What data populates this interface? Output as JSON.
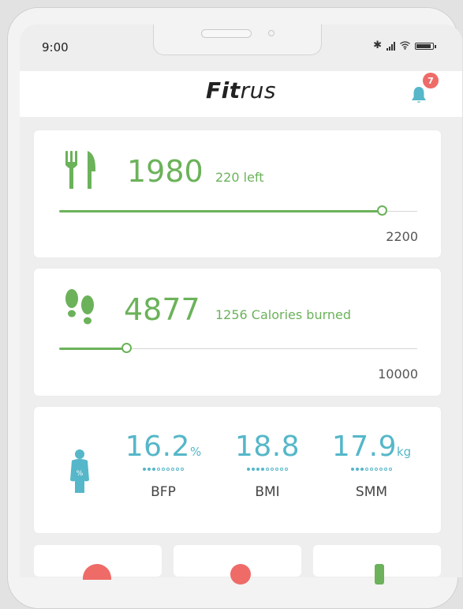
{
  "status_bar": {
    "time": "9:00"
  },
  "header": {
    "title_bold": "Fit",
    "title_rest": "rus",
    "notification_count": "7"
  },
  "calories_card": {
    "value": "1980",
    "remaining_text": "220 left",
    "goal": "2200",
    "progress_fraction": 0.9
  },
  "steps_card": {
    "value": "4877",
    "calories_text": "1256 Calories burned",
    "goal": "10000",
    "progress_fraction": 0.1875
  },
  "body_card": {
    "metrics": [
      {
        "value": "16.2",
        "unit": "%",
        "label": "BFP",
        "dots_filled": 3,
        "dots_total": 9
      },
      {
        "value": "18.8",
        "unit": "",
        "label": "BMI",
        "dots_filled": 4,
        "dots_total": 9
      },
      {
        "value": "17.9",
        "unit": "kg",
        "label": "SMM",
        "dots_filled": 3,
        "dots_total": 9
      }
    ]
  },
  "colors": {
    "accent_green": "#6bb25a",
    "accent_teal": "#55b7c9",
    "badge_red": "#ee6b67"
  },
  "icons": [
    "fork-knife-icon",
    "footprints-icon",
    "body-composition-icon",
    "bell-icon"
  ]
}
